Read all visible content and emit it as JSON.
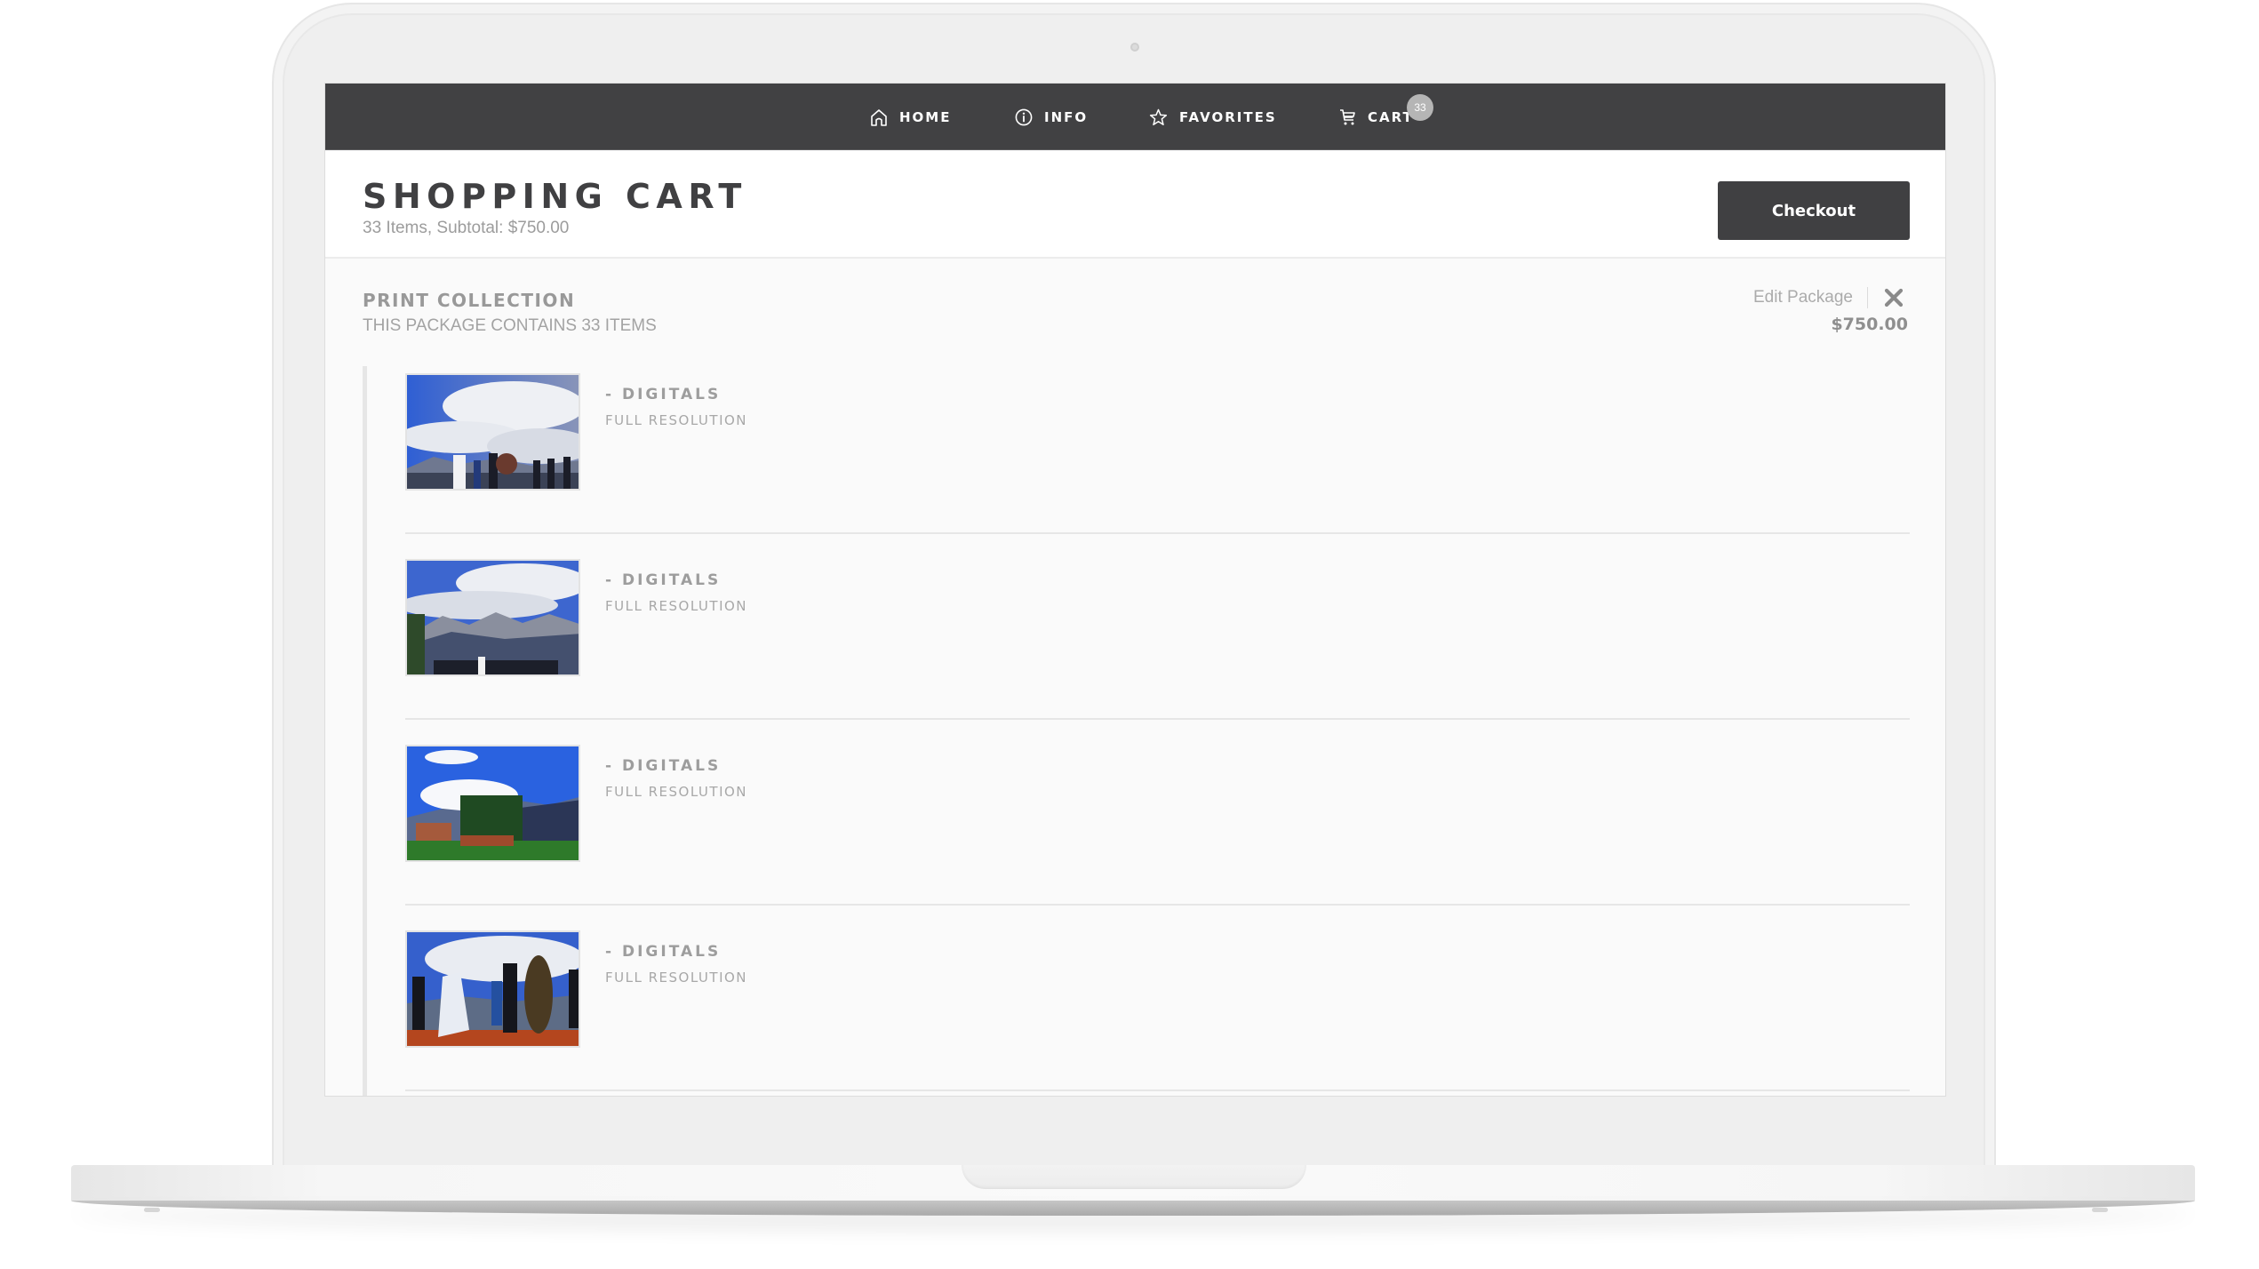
{
  "nav": {
    "items": [
      {
        "label": "HOME",
        "icon": "home-icon"
      },
      {
        "label": "INFO",
        "icon": "info-icon"
      },
      {
        "label": "FAVORITES",
        "icon": "star-icon"
      },
      {
        "label": "CART",
        "icon": "cart-icon"
      }
    ],
    "cart_count": "33"
  },
  "header": {
    "title": "SHOPPING CART",
    "subtitle": "33 Items, Subtotal: $750.00",
    "checkout_label": "Checkout"
  },
  "package": {
    "title": "PRINT COLLECTION",
    "subtitle": "THIS PACKAGE CONTAINS 33 ITEMS",
    "edit_label": "Edit Package",
    "remove_icon": "close-icon",
    "price": "$750.00",
    "items": [
      {
        "name": "- DIGITALS",
        "description": "FULL RESOLUTION",
        "thumbnail": "wedding-ceremony-clouds"
      },
      {
        "name": "- DIGITALS",
        "description": "FULL RESOLUTION",
        "thumbnail": "mountain-ceremony-wide"
      },
      {
        "name": "- DIGITALS",
        "description": "FULL RESOLUTION",
        "thumbnail": "venue-meadow-mountains"
      },
      {
        "name": "- DIGITALS",
        "description": "FULL RESOLUTION",
        "thumbnail": "bride-groom-altar"
      }
    ]
  },
  "colors": {
    "navbar": "#414143",
    "button": "#404042",
    "badge": "#b5b5b5",
    "muted_text": "#999999"
  }
}
